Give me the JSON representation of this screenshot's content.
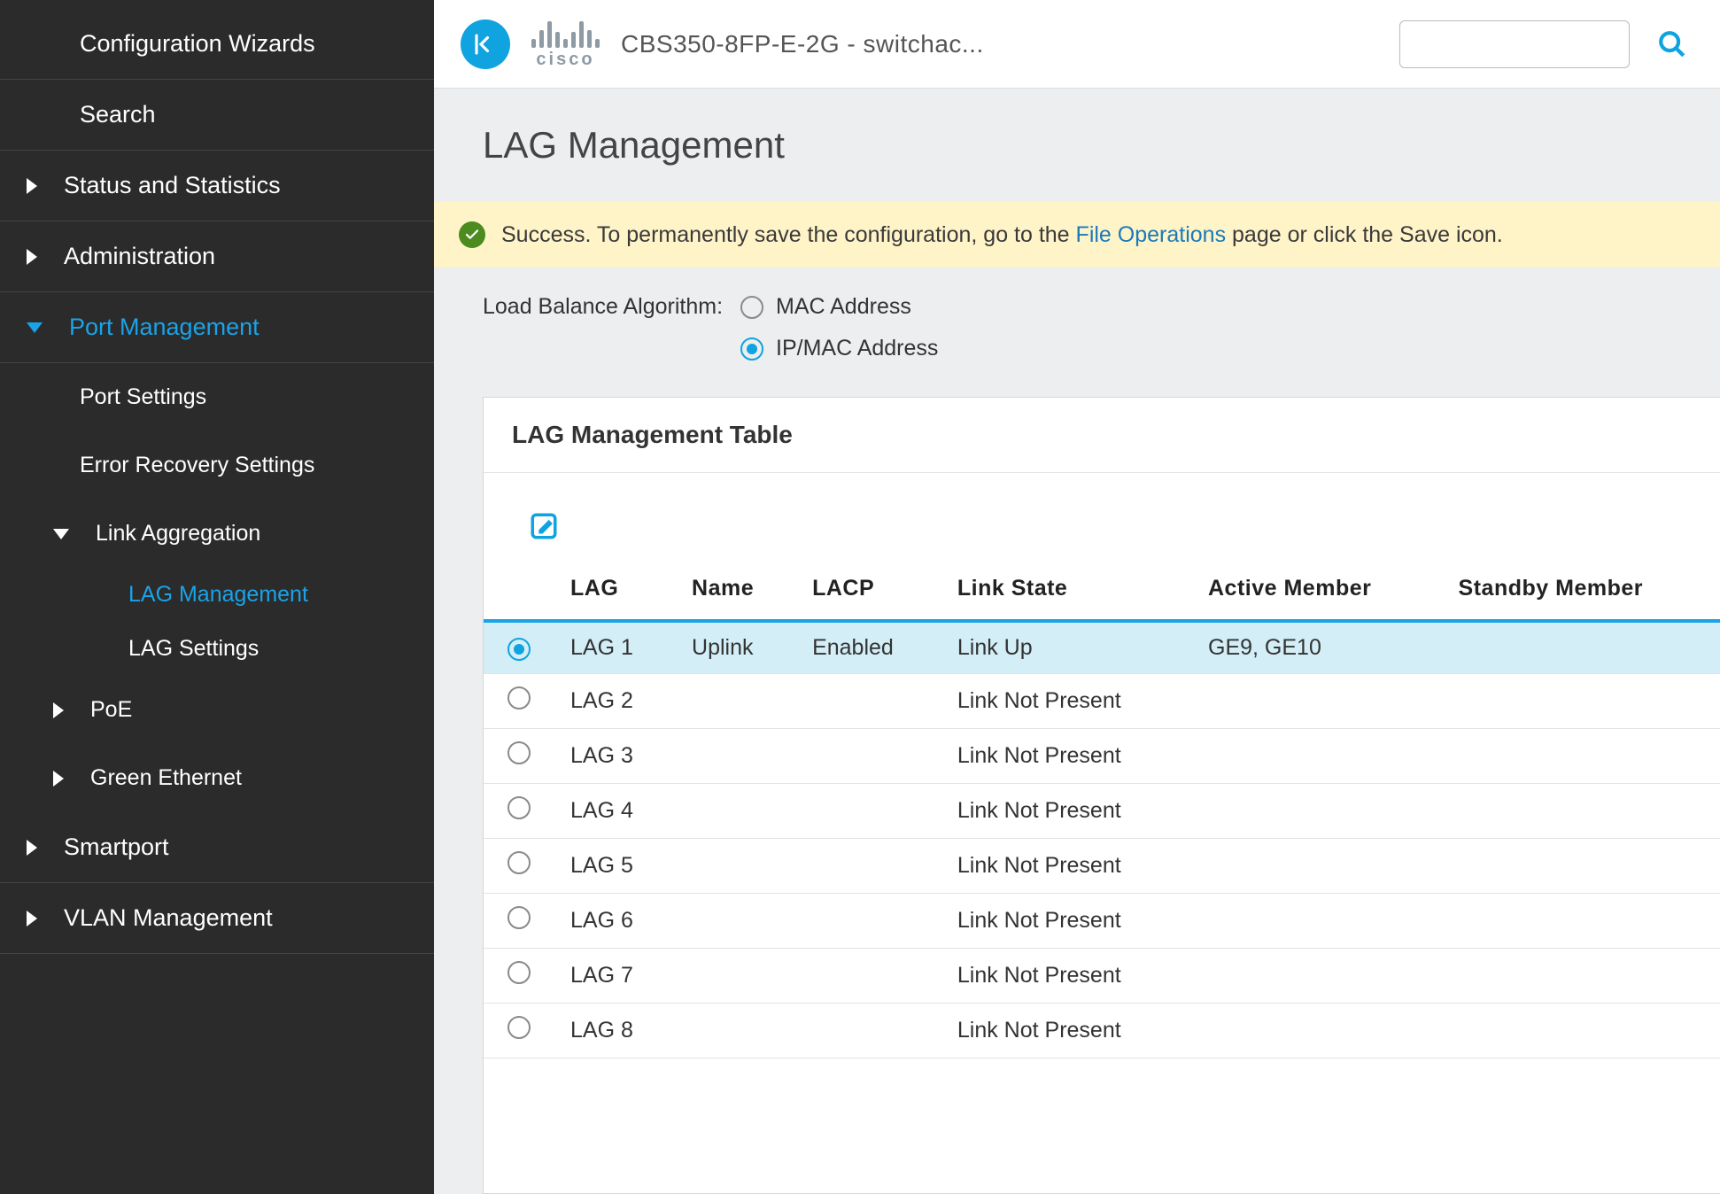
{
  "header": {
    "device_name": "CBS350-8FP-E-2G - switchac...",
    "search_placeholder": ""
  },
  "page_title": "LAG Management",
  "alert": {
    "prefix": "Success. To permanently save the configuration, go to the ",
    "link": "File Operations",
    "suffix": " page or click the Save icon."
  },
  "lba": {
    "label": "Load Balance Algorithm:",
    "options": [
      {
        "label": "MAC Address",
        "checked": false
      },
      {
        "label": "IP/MAC Address",
        "checked": true
      }
    ]
  },
  "panel_title": "LAG Management Table",
  "table": {
    "columns": [
      "LAG",
      "Name",
      "LACP",
      "Link State",
      "Active Member",
      "Standby Member"
    ],
    "rows": [
      {
        "selected": true,
        "lag": "LAG 1",
        "name": "Uplink",
        "lacp": "Enabled",
        "link": "Link Up",
        "active": "GE9, GE10",
        "standby": ""
      },
      {
        "selected": false,
        "lag": "LAG 2",
        "name": "",
        "lacp": "",
        "link": "Link Not Present",
        "active": "",
        "standby": ""
      },
      {
        "selected": false,
        "lag": "LAG 3",
        "name": "",
        "lacp": "",
        "link": "Link Not Present",
        "active": "",
        "standby": ""
      },
      {
        "selected": false,
        "lag": "LAG 4",
        "name": "",
        "lacp": "",
        "link": "Link Not Present",
        "active": "",
        "standby": ""
      },
      {
        "selected": false,
        "lag": "LAG 5",
        "name": "",
        "lacp": "",
        "link": "Link Not Present",
        "active": "",
        "standby": ""
      },
      {
        "selected": false,
        "lag": "LAG 6",
        "name": "",
        "lacp": "",
        "link": "Link Not Present",
        "active": "",
        "standby": ""
      },
      {
        "selected": false,
        "lag": "LAG 7",
        "name": "",
        "lacp": "",
        "link": "Link Not Present",
        "active": "",
        "standby": ""
      },
      {
        "selected": false,
        "lag": "LAG 8",
        "name": "",
        "lacp": "",
        "link": "Link Not Present",
        "active": "",
        "standby": ""
      }
    ]
  },
  "sidebar": [
    {
      "label": "Configuration Wizards",
      "level": 0,
      "caret": null,
      "active": false
    },
    {
      "label": "Search",
      "level": 0,
      "caret": null,
      "active": false
    },
    {
      "label": "Status and Statistics",
      "level": 0,
      "caret": "right",
      "active": false
    },
    {
      "label": "Administration",
      "level": 0,
      "caret": "right",
      "active": false
    },
    {
      "label": "Port Management",
      "level": 0,
      "caret": "down",
      "active": true
    },
    {
      "label": "Port Settings",
      "level": 1,
      "caret": null,
      "active": false
    },
    {
      "label": "Error Recovery Settings",
      "level": 1,
      "caret": null,
      "active": false
    },
    {
      "label": "Link Aggregation",
      "level": 1,
      "caret": "down",
      "active": false
    },
    {
      "label": "LAG Management",
      "level": 2,
      "caret": null,
      "active": true
    },
    {
      "label": "LAG Settings",
      "level": 2,
      "caret": null,
      "active": false
    },
    {
      "label": "PoE",
      "level": 1,
      "caret": "right",
      "active": false
    },
    {
      "label": "Green Ethernet",
      "level": 1,
      "caret": "right",
      "active": false
    },
    {
      "label": "Smartport",
      "level": 0,
      "caret": "right",
      "active": false
    },
    {
      "label": "VLAN Management",
      "level": 0,
      "caret": "right",
      "active": false
    }
  ],
  "cisco_bars": [
    10,
    20,
    30,
    18,
    10,
    18,
    30,
    20,
    10
  ]
}
